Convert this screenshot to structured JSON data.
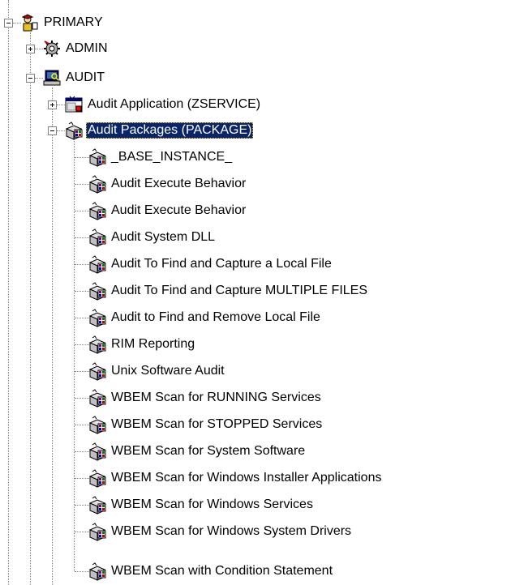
{
  "tree": {
    "root": {
      "label": "PRIMARY",
      "icon": "primary-user-icon",
      "expanded": true
    },
    "admin": {
      "label": "ADMIN",
      "icon": "admin-gear-icon",
      "expanded": false
    },
    "audit": {
      "label": "AUDIT",
      "icon": "audit-computer-icon",
      "expanded": true
    },
    "audit_application": {
      "label": "Audit Application (ZSERVICE)",
      "icon": "application-window-icon",
      "expanded": false
    },
    "audit_packages": {
      "label": "Audit Packages (PACKAGE)",
      "icon": "package-icon",
      "expanded": true,
      "selected": true
    },
    "packages": [
      "_BASE_INSTANCE_",
      "Audit Execute Behavior",
      "Audit Execute Behavior",
      "Audit System DLL",
      "Audit To Find and Capture a Local File",
      "Audit To Find and Capture MULTIPLE FILES",
      "Audit to Find and Remove Local File",
      "RIM Reporting",
      "Unix Software Audit",
      "WBEM Scan for RUNNING Services",
      "WBEM Scan for STOPPED Services",
      "WBEM Scan for System Software",
      "WBEM Scan for Windows Installer Applications",
      "WBEM Scan for Windows Services",
      "WBEM Scan for Windows System Drivers",
      "WBEM Scan with Condition Statement"
    ]
  },
  "colors": {
    "selection_background": "#0a246a",
    "selection_text": "#ffffff",
    "connector_line": "#808080"
  }
}
